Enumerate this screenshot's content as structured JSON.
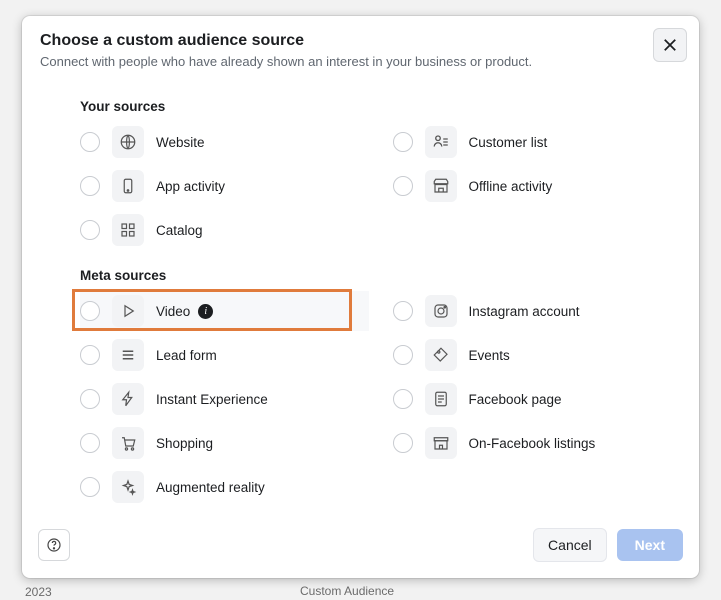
{
  "header": {
    "title": "Choose a custom audience source",
    "subtitle": "Connect with people who have already shown an interest in your business or product."
  },
  "section_your": "Your sources",
  "section_meta": "Meta sources",
  "your_sources": {
    "website": "Website",
    "app_activity": "App activity",
    "catalog": "Catalog",
    "customer_list": "Customer list",
    "offline_activity": "Offline activity"
  },
  "meta_sources": {
    "video": "Video",
    "lead_form": "Lead form",
    "instant_experience": "Instant Experience",
    "shopping": "Shopping",
    "augmented_reality": "Augmented reality",
    "instagram_account": "Instagram account",
    "events": "Events",
    "facebook_page": "Facebook page",
    "on_facebook_listings": "On-Facebook listings"
  },
  "footer": {
    "cancel": "Cancel",
    "next": "Next"
  },
  "bg": {
    "year": "2023",
    "text": "Custom Audience"
  }
}
